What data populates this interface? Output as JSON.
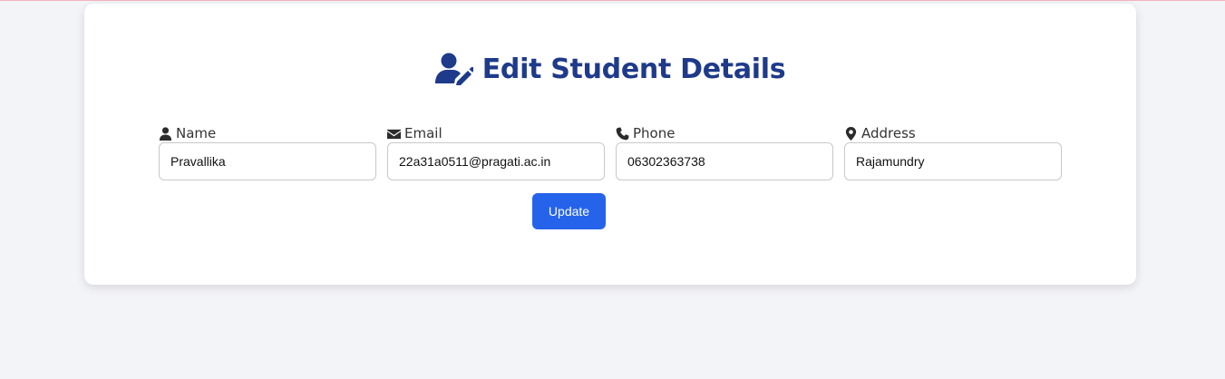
{
  "page": {
    "title": "Edit Student Details",
    "title_icon": "user-edit-icon",
    "accent_color": "#1e3a8a",
    "button_color": "#2563eb"
  },
  "form": {
    "fields": [
      {
        "label": "Name",
        "icon": "user-icon",
        "value": "Pravallika"
      },
      {
        "label": "Email",
        "icon": "envelope-icon",
        "value": "22a31a0511@pragati.ac.in"
      },
      {
        "label": "Phone",
        "icon": "phone-icon",
        "value": "06302363738"
      },
      {
        "label": "Address",
        "icon": "map-pin-icon",
        "value": "Rajamundry"
      }
    ],
    "submit_label": "Update"
  }
}
